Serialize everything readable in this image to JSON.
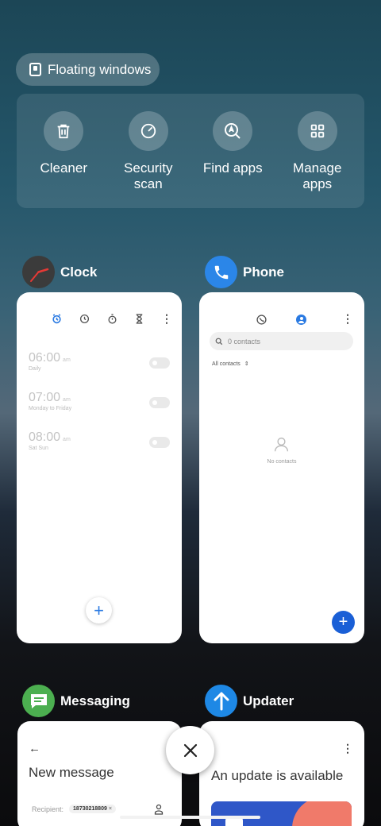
{
  "floating": {
    "label": "Floating windows",
    "icon": "floating-window-icon"
  },
  "tools": [
    {
      "label": "Cleaner",
      "icon": "trash-icon"
    },
    {
      "label": "Security\nscan",
      "icon": "security-scan-icon"
    },
    {
      "label": "Find apps",
      "icon": "find-apps-icon"
    },
    {
      "label": "Manage\napps",
      "icon": "grid-icon"
    }
  ],
  "clock": {
    "name": "Clock",
    "alarms": [
      {
        "time": "06:00",
        "ampm": "am",
        "repeat": "Daily"
      },
      {
        "time": "07:00",
        "ampm": "am",
        "repeat": "Monday to Friday"
      },
      {
        "time": "08:00",
        "ampm": "am",
        "repeat": "Sat Sun"
      }
    ],
    "add": "+"
  },
  "phone": {
    "name": "Phone",
    "search_placeholder": "0 contacts",
    "filter": "All contacts",
    "empty": "No contacts",
    "add": "+"
  },
  "messaging": {
    "name": "Messaging",
    "title": "New message",
    "recipient_label": "Recipient:",
    "recipient": "18730218809"
  },
  "updater": {
    "name": "Updater",
    "title": "An update is available"
  },
  "colors": {
    "accent": "#2a7ae2",
    "fab": "#1a5fd6",
    "messaging": "#4caf50",
    "updater": "#1e88e5"
  }
}
